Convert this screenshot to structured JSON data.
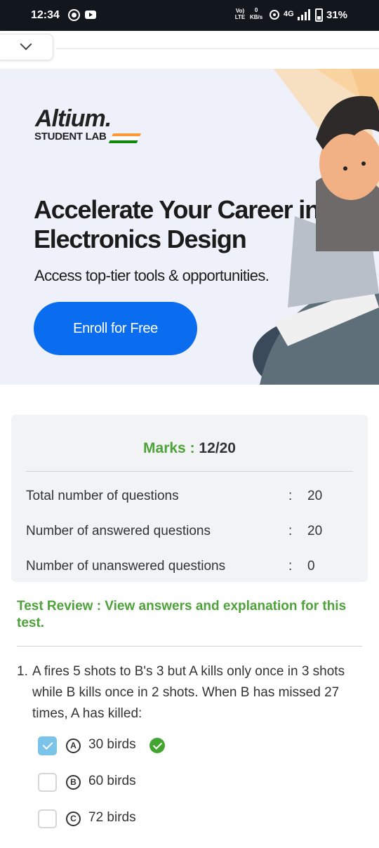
{
  "status_bar": {
    "time": "12:34",
    "volte": "Vo) LTE",
    "speed_value": "0",
    "speed_unit": "KB/s",
    "network": "4G",
    "battery": "31%"
  },
  "ad": {
    "logo": "Altium.",
    "logo_sub": "STUDENT LAB",
    "headline": "Accelerate Your Career in Electronics Design",
    "subtext": "Access top-tier tools & opportunities.",
    "cta": "Enroll for Free",
    "info_icon": "i",
    "close_icon": "✕",
    "flag_colors": [
      "#ff9933",
      "#ffffff",
      "#138808"
    ],
    "button_color": "#0a6df0"
  },
  "results": {
    "marks_label": "Marks :",
    "marks_value": "12/20",
    "stats": [
      {
        "label": "Total number of questions",
        "colon": ":",
        "value": "20"
      },
      {
        "label": "Number of answered questions",
        "colon": ":",
        "value": "20"
      },
      {
        "label": "Number of unanswered questions",
        "colon": ":",
        "value": "0"
      }
    ],
    "review_link": "Test Review : View answers and explanation for this test."
  },
  "question": {
    "number": "1.",
    "text": "A fires 5 shots to B's 3 but A kills only once in 3 shots while B kills once in 2 shots. When B has missed 27 times, A has killed:",
    "options": [
      {
        "letter": "A",
        "text": "30 birds",
        "checked": true,
        "correct": true
      },
      {
        "letter": "B",
        "text": "60 birds",
        "checked": false,
        "correct": false
      },
      {
        "letter": "C",
        "text": "72 birds",
        "checked": false,
        "correct": false
      }
    ]
  },
  "colors": {
    "accent_green": "#4ea23a",
    "check_blue": "#7cc3ea"
  }
}
